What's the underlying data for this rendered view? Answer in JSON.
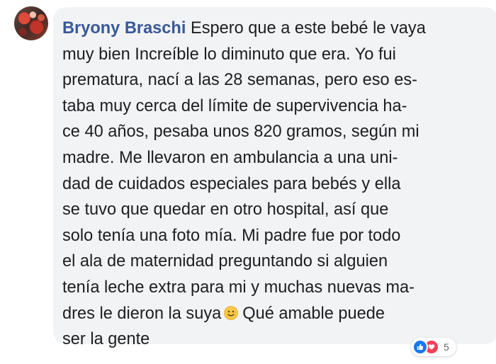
{
  "comment": {
    "author": "Bryony Braschi",
    "line_1": "Espero que a este bebé le vaya",
    "line_2": "muy bien Increíble lo diminuto  que era. Yo fui",
    "line_3": "prematura, nací a las 28 semanas, pero eso es-",
    "line_4": "taba muy cerca del límite de supervivencia ha-",
    "line_5": "ce 40 años, pesaba unos 820 gramos, según mi",
    "line_6": "madre. Me llevaron en ambulancia a una uni-",
    "line_7": "dad de cuidados especiales para bebés y ella",
    "line_8": "se tuvo que quedar en otro hospital, así que",
    "line_9": "solo tenía una foto mía. Mi padre fue por todo",
    "line_10": "el ala de maternidad preguntando si alguien",
    "line_11": "tenía leche extra para mi y muchas nuevas ma-",
    "line_12a": "dres le dieron la suya",
    "emoji": "slightly-smiling-face",
    "line_12b": "Qué amable puede",
    "line_13": "ser la gente"
  },
  "reactions": {
    "icons": [
      "like-icon",
      "love-icon"
    ],
    "count": "5",
    "colors": {
      "like": "#1877f2",
      "love": "#f33e58"
    }
  },
  "colors": {
    "author": "#385898",
    "text": "#1c1e21",
    "bubble": "#f2f3f5"
  }
}
